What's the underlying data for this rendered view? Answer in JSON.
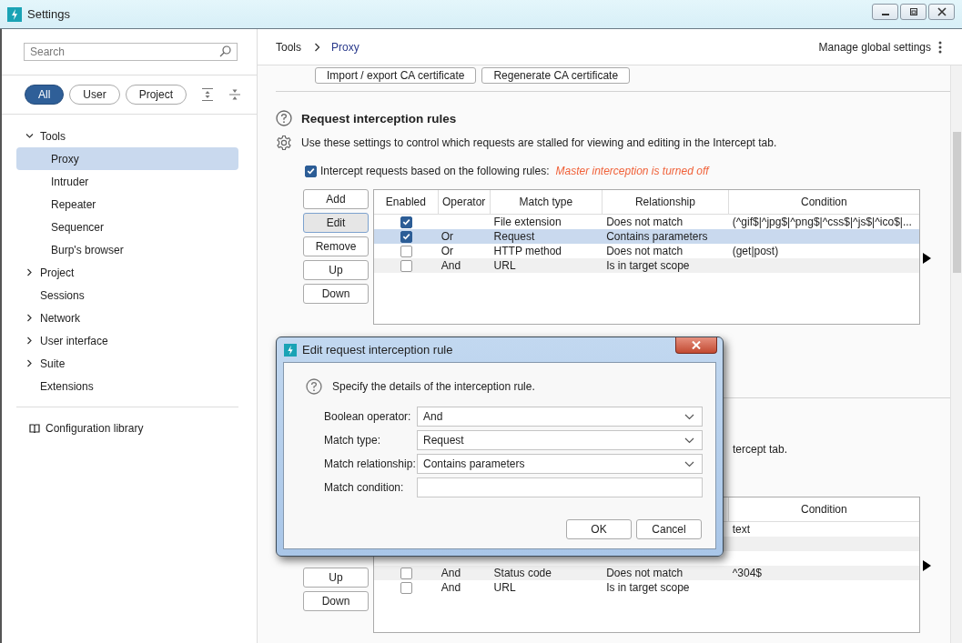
{
  "window": {
    "title": "Settings"
  },
  "sidebar": {
    "search": {
      "placeholder": "Search"
    },
    "filters": [
      {
        "label": "All",
        "selected": true
      },
      {
        "label": "User",
        "selected": false
      },
      {
        "label": "Project",
        "selected": false
      }
    ],
    "tree": [
      {
        "label": "Tools",
        "expanded": true,
        "selected": false,
        "children": [
          {
            "label": "Proxy",
            "selected": true
          },
          {
            "label": "Intruder",
            "selected": false
          },
          {
            "label": "Repeater",
            "selected": false
          },
          {
            "label": "Sequencer",
            "selected": false
          },
          {
            "label": "Burp's browser",
            "selected": false
          }
        ]
      },
      {
        "label": "Project",
        "expanded": false,
        "selected": false
      },
      {
        "label": "Sessions",
        "selected": false
      },
      {
        "label": "Network",
        "expanded": false,
        "selected": false
      },
      {
        "label": "User interface",
        "expanded": false,
        "selected": false
      },
      {
        "label": "Suite",
        "expanded": false,
        "selected": false
      },
      {
        "label": "Extensions",
        "selected": false
      }
    ],
    "library": "Configuration library"
  },
  "header": {
    "breadcrumb": [
      {
        "label": "Tools",
        "selected": false
      },
      {
        "label": "Proxy",
        "selected": true
      }
    ],
    "manage": "Manage global settings"
  },
  "certificate_buttons": [
    "Import / export CA certificate",
    "Regenerate CA certificate"
  ],
  "request_rules": {
    "title": "Request interception rules",
    "description": "Use these settings to control which requests are stalled for viewing and editing in the Intercept tab.",
    "intercept": {
      "checked": true,
      "label": "Intercept requests based on the following rules:",
      "status": "Master interception is turned off"
    },
    "buttons": [
      {
        "label": "Add",
        "focused": false
      },
      {
        "label": "Edit",
        "focused": true
      },
      {
        "label": "Remove",
        "focused": false
      },
      {
        "label": "Up",
        "focused": false
      },
      {
        "label": "Down",
        "focused": false
      }
    ],
    "columns": [
      "Enabled",
      "Operator",
      "Match type",
      "Relationship",
      "Condition"
    ],
    "rows": [
      {
        "enabled": true,
        "match_type": "File extension",
        "relationship": "Does not match",
        "condition": "(^gif$|^jpg$|^png$|^css$|^js$|^ico$|...",
        "selected": false
      },
      {
        "enabled": true,
        "operator": "Or",
        "match_type": "Request",
        "relationship": "Contains parameters",
        "selected": true
      },
      {
        "enabled": false,
        "operator": "Or",
        "match_type": "HTTP method",
        "relationship": "Does not match",
        "condition": "(get|post)",
        "selected": false
      },
      {
        "enabled": false,
        "operator": "And",
        "match_type": "URL",
        "relationship": "Is in target scope",
        "selected": false
      }
    ]
  },
  "response_rules": {
    "description": "tercept tab.",
    "buttons": [
      {
        "label": "Up",
        "focused": false
      },
      {
        "label": "Down",
        "focused": false
      }
    ],
    "columns": [
      "Condition"
    ],
    "rows": [
      {
        "condition": "text",
        "selected": false
      },
      {
        "selected": false
      },
      {
        "selected": false
      },
      {
        "enabled": false,
        "operator": "And",
        "match_type": "Status code",
        "relationship": "Does not match",
        "condition": "^304$",
        "selected": false
      },
      {
        "enabled": false,
        "operator": "And",
        "match_type": "URL",
        "relationship": "Is in target scope",
        "selected": false
      }
    ]
  },
  "dialog": {
    "title": "Edit request interception rule",
    "message": "Specify the details of the interception rule.",
    "fields": [
      {
        "kind": "dropdown",
        "label": "Boolean operator:",
        "value": "And"
      },
      {
        "kind": "dropdown",
        "label": "Match type:",
        "value": "Request"
      },
      {
        "kind": "dropdown",
        "label": "Match relationship:",
        "value": "Contains parameters"
      },
      {
        "kind": "text",
        "label": "Match condition:"
      }
    ],
    "buttons": [
      "OK",
      "Cancel"
    ]
  }
}
